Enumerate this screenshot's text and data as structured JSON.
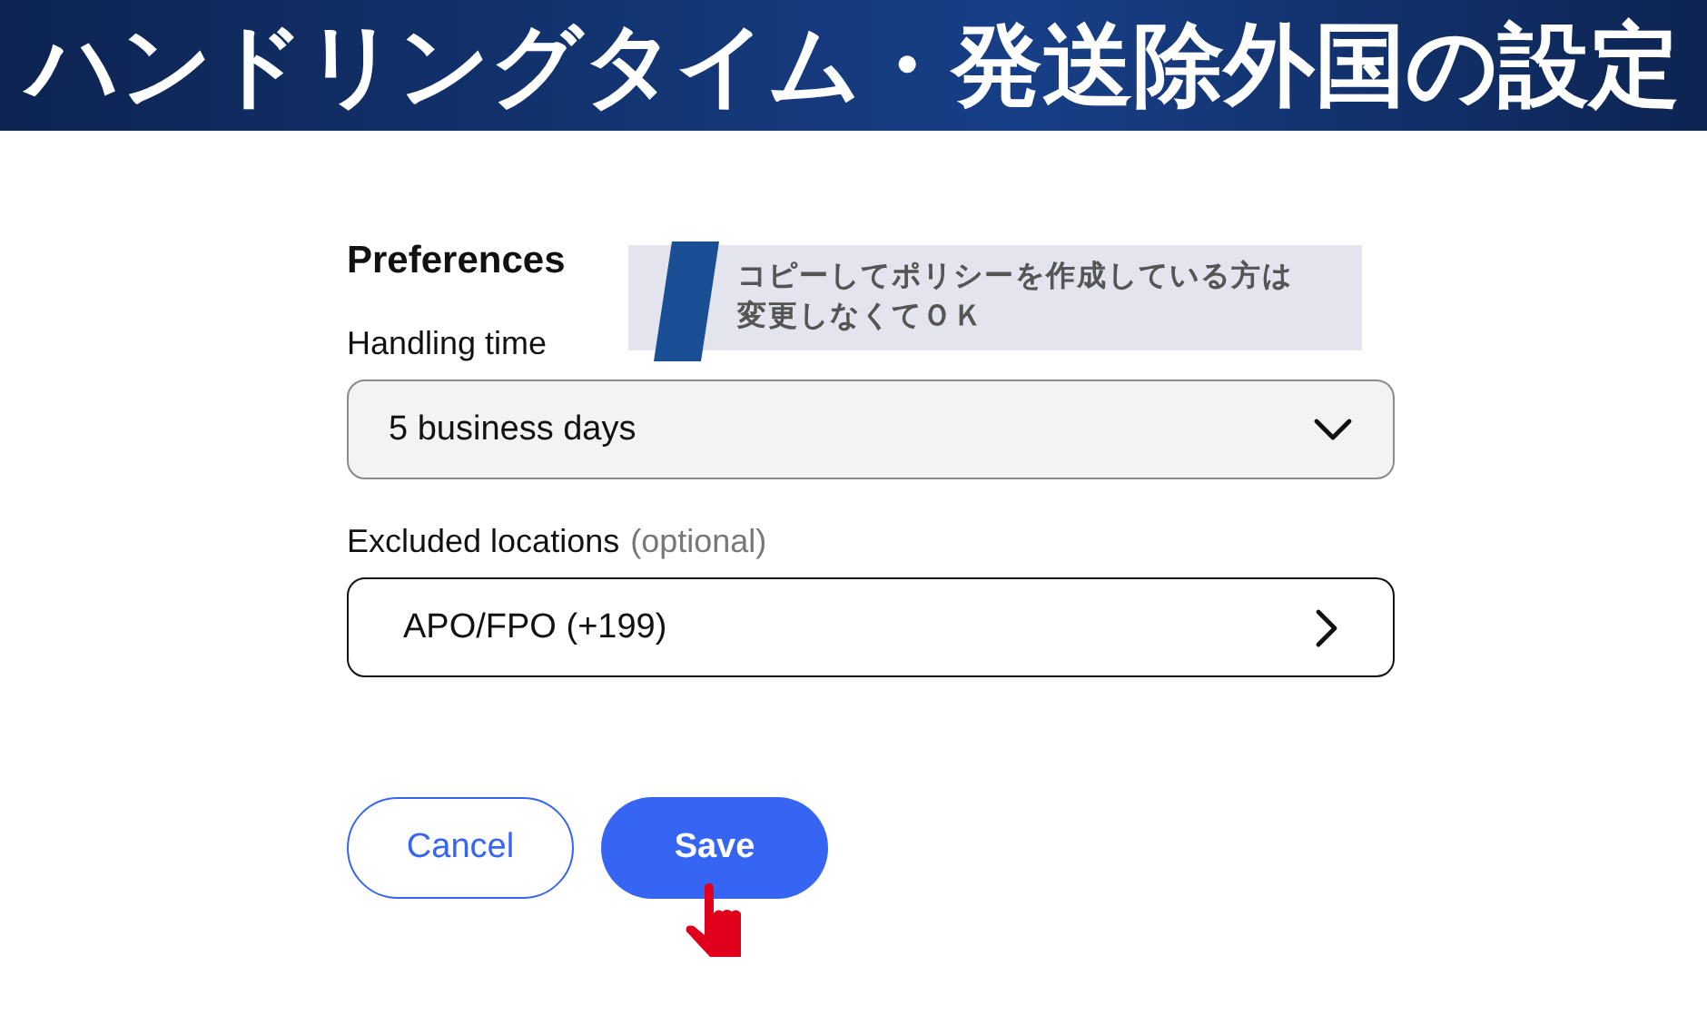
{
  "banner": {
    "title": "ハンドリングタイム・発送除外国の設定"
  },
  "heading": "Preferences",
  "note": {
    "lines": [
      "コピーしてポリシーを作成している方は",
      "変更しなくてＯＫ"
    ]
  },
  "fields": [
    {
      "kind": "dropdown",
      "label": "Handling time",
      "value": "5 business days"
    },
    {
      "kind": "link",
      "label": "Excluded locations",
      "hint": "(optional)",
      "value": "APO/FPO (+199)"
    }
  ],
  "buttons": [
    {
      "kind": "secondary",
      "label": "Cancel"
    },
    {
      "kind": "primary",
      "label": "Save",
      "pointer": true
    }
  ]
}
